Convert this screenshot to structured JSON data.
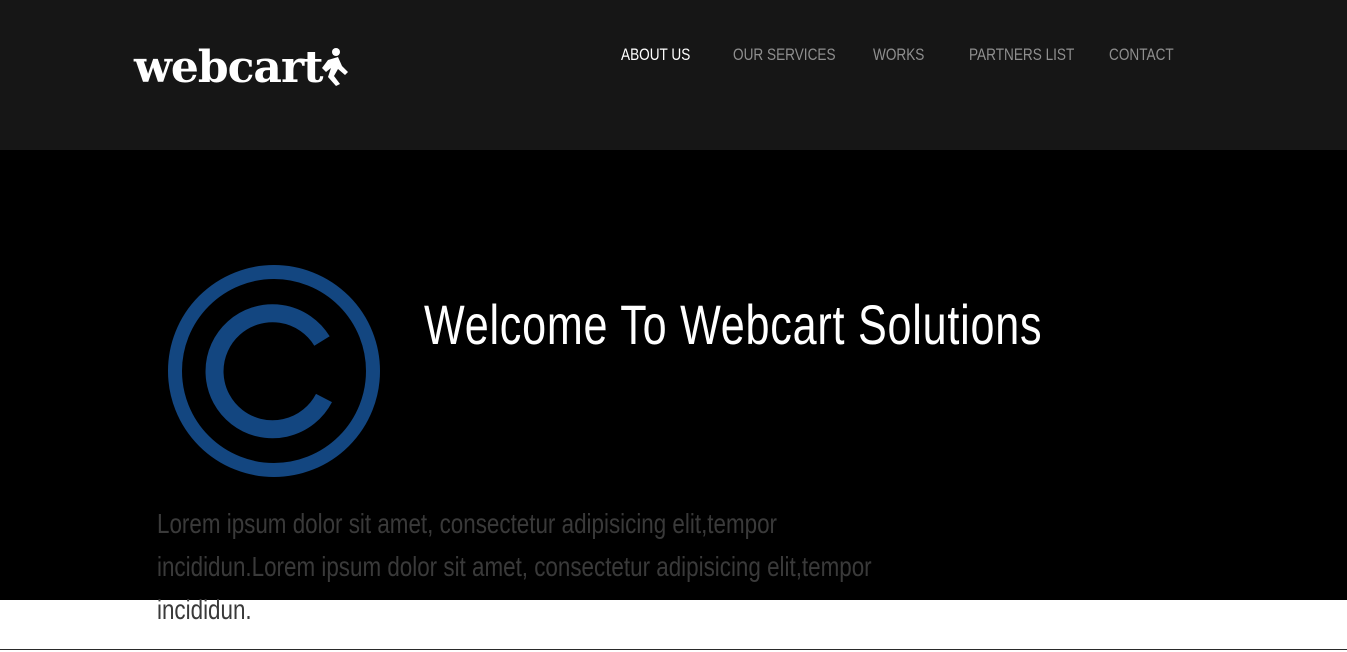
{
  "brand": {
    "logo_text": "webcart"
  },
  "nav": [
    {
      "label": "ABOUT US",
      "active": true
    },
    {
      "label": "OUR SERVICES",
      "active": false
    },
    {
      "label": "WORKS",
      "active": false
    },
    {
      "label": "PARTNERS LIST",
      "active": false
    },
    {
      "label": "CONTACT",
      "active": false
    }
  ],
  "hero": {
    "title": "Welcome To Webcart Solutions",
    "body": "Lorem ipsum dolor sit amet, consectetur adipisicing elit,tempor incididun.Lorem ipsum dolor sit amet, consectetur adipisicing elit,tempor incididun.",
    "icon": "copyright-icon",
    "icon_color": "#134680"
  },
  "colors": {
    "header_bg": "#161616",
    "hero_bg": "#000000",
    "nav_active": "#ffffff",
    "nav_inactive": "#8f8f8f",
    "body_text": "#3a3a3a"
  }
}
